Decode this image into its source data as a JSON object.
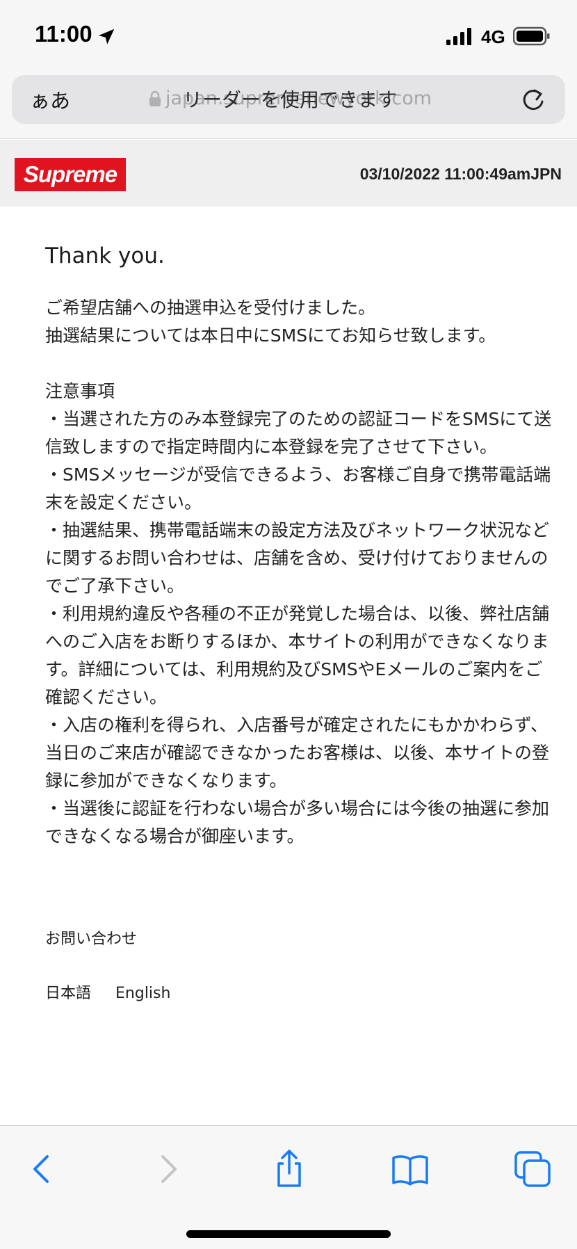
{
  "status_bar": {
    "time": "11:00",
    "network": "4G",
    "icons": [
      "location-arrow-icon",
      "cellular-signal-icon",
      "battery-icon"
    ]
  },
  "address_bar": {
    "aa_label": "ぁあ",
    "url": "japan.supremenewyork.com",
    "reader_banner": "リーダーを使用できます",
    "icons": [
      "lock-icon",
      "reload-icon"
    ]
  },
  "site_header": {
    "logo": "Supreme",
    "timestamp": "03/10/2022 11:00:49amJPN",
    "colors": {
      "logo_bg": "#e0131f"
    }
  },
  "content": {
    "heading": "Thank you.",
    "intro": [
      "ご希望店舗への抽選申込を受付けました。",
      "抽選結果については本日中にSMSにてお知らせ致します。"
    ],
    "notice_title": "注意事項",
    "notices": [
      "・当選された方のみ本登録完了のための認証コードをSMSにて送信致しますので指定時間内に本登録を完了させて下さい。",
      "・SMSメッセージが受信できるよう、お客様ご自身で携帯電話端末を設定ください。",
      "・抽選結果、携帯電話端末の設定方法及びネットワーク状況などに関するお問い合わせは、店舗を含め、受け付けておりませんのでご了承下さい。",
      "・利用規約違反や各種の不正が発覚した場合は、以後、弊社店舗へのご入店をお断りするほか、本サイトの利用ができなくなります。詳細については、利用規約及びSMSやEメールのご案内をご確認ください。",
      "・入店の権利を得られ、入店番号が確定されたにもかかわらず、当日のご来店が確認できなかったお客様は、以後、本サイトの登録に参加ができなくなります。",
      "・当選後に認証を行わない場合が多い場合には今後の抽選に参加できなくなる場合が御座います。"
    ],
    "contact": "お問い合わせ",
    "languages": [
      "日本語",
      "English"
    ]
  },
  "toolbar": {
    "icons": [
      "back-icon",
      "forward-icon",
      "share-icon",
      "bookmarks-icon",
      "tabs-icon"
    ],
    "colors": {
      "active": "#1a7cf5",
      "disabled": "#c4c4c8"
    }
  }
}
